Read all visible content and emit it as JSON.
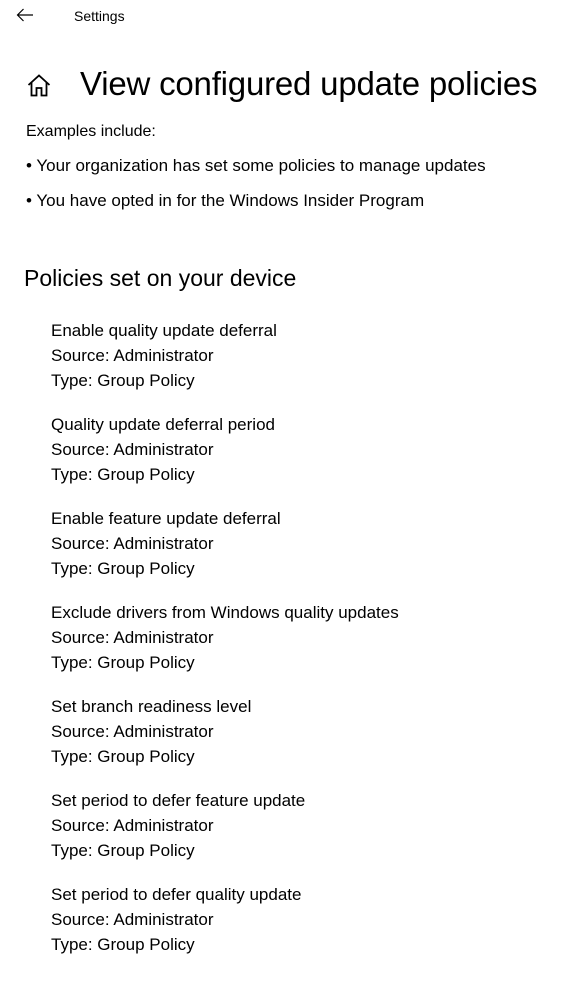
{
  "app": {
    "title": "Settings"
  },
  "header": {
    "page_title": "View configured update policies"
  },
  "intro": {
    "examples_label": "Examples include:",
    "bullets": [
      "• Your organization has set some policies to manage updates",
      "• You have opted in for the Windows Insider Program"
    ]
  },
  "section": {
    "title": "Policies set on your device"
  },
  "policies": [
    {
      "name": "Enable quality update deferral",
      "source": "Source: Administrator",
      "type": "Type: Group Policy"
    },
    {
      "name": "Quality update deferral period",
      "source": "Source: Administrator",
      "type": "Type: Group Policy"
    },
    {
      "name": "Enable feature update deferral",
      "source": "Source: Administrator",
      "type": "Type: Group Policy"
    },
    {
      "name": "Exclude drivers from Windows quality updates",
      "source": "Source: Administrator",
      "type": "Type: Group Policy"
    },
    {
      "name": "Set branch readiness level",
      "source": "Source: Administrator",
      "type": "Type: Group Policy"
    },
    {
      "name": "Set period to defer feature update",
      "source": "Source: Administrator",
      "type": "Type: Group Policy"
    },
    {
      "name": "Set period to defer quality update",
      "source": "Source: Administrator",
      "type": "Type: Group Policy"
    }
  ],
  "icons": {
    "back": "arrow-left-icon",
    "home": "home-icon"
  }
}
